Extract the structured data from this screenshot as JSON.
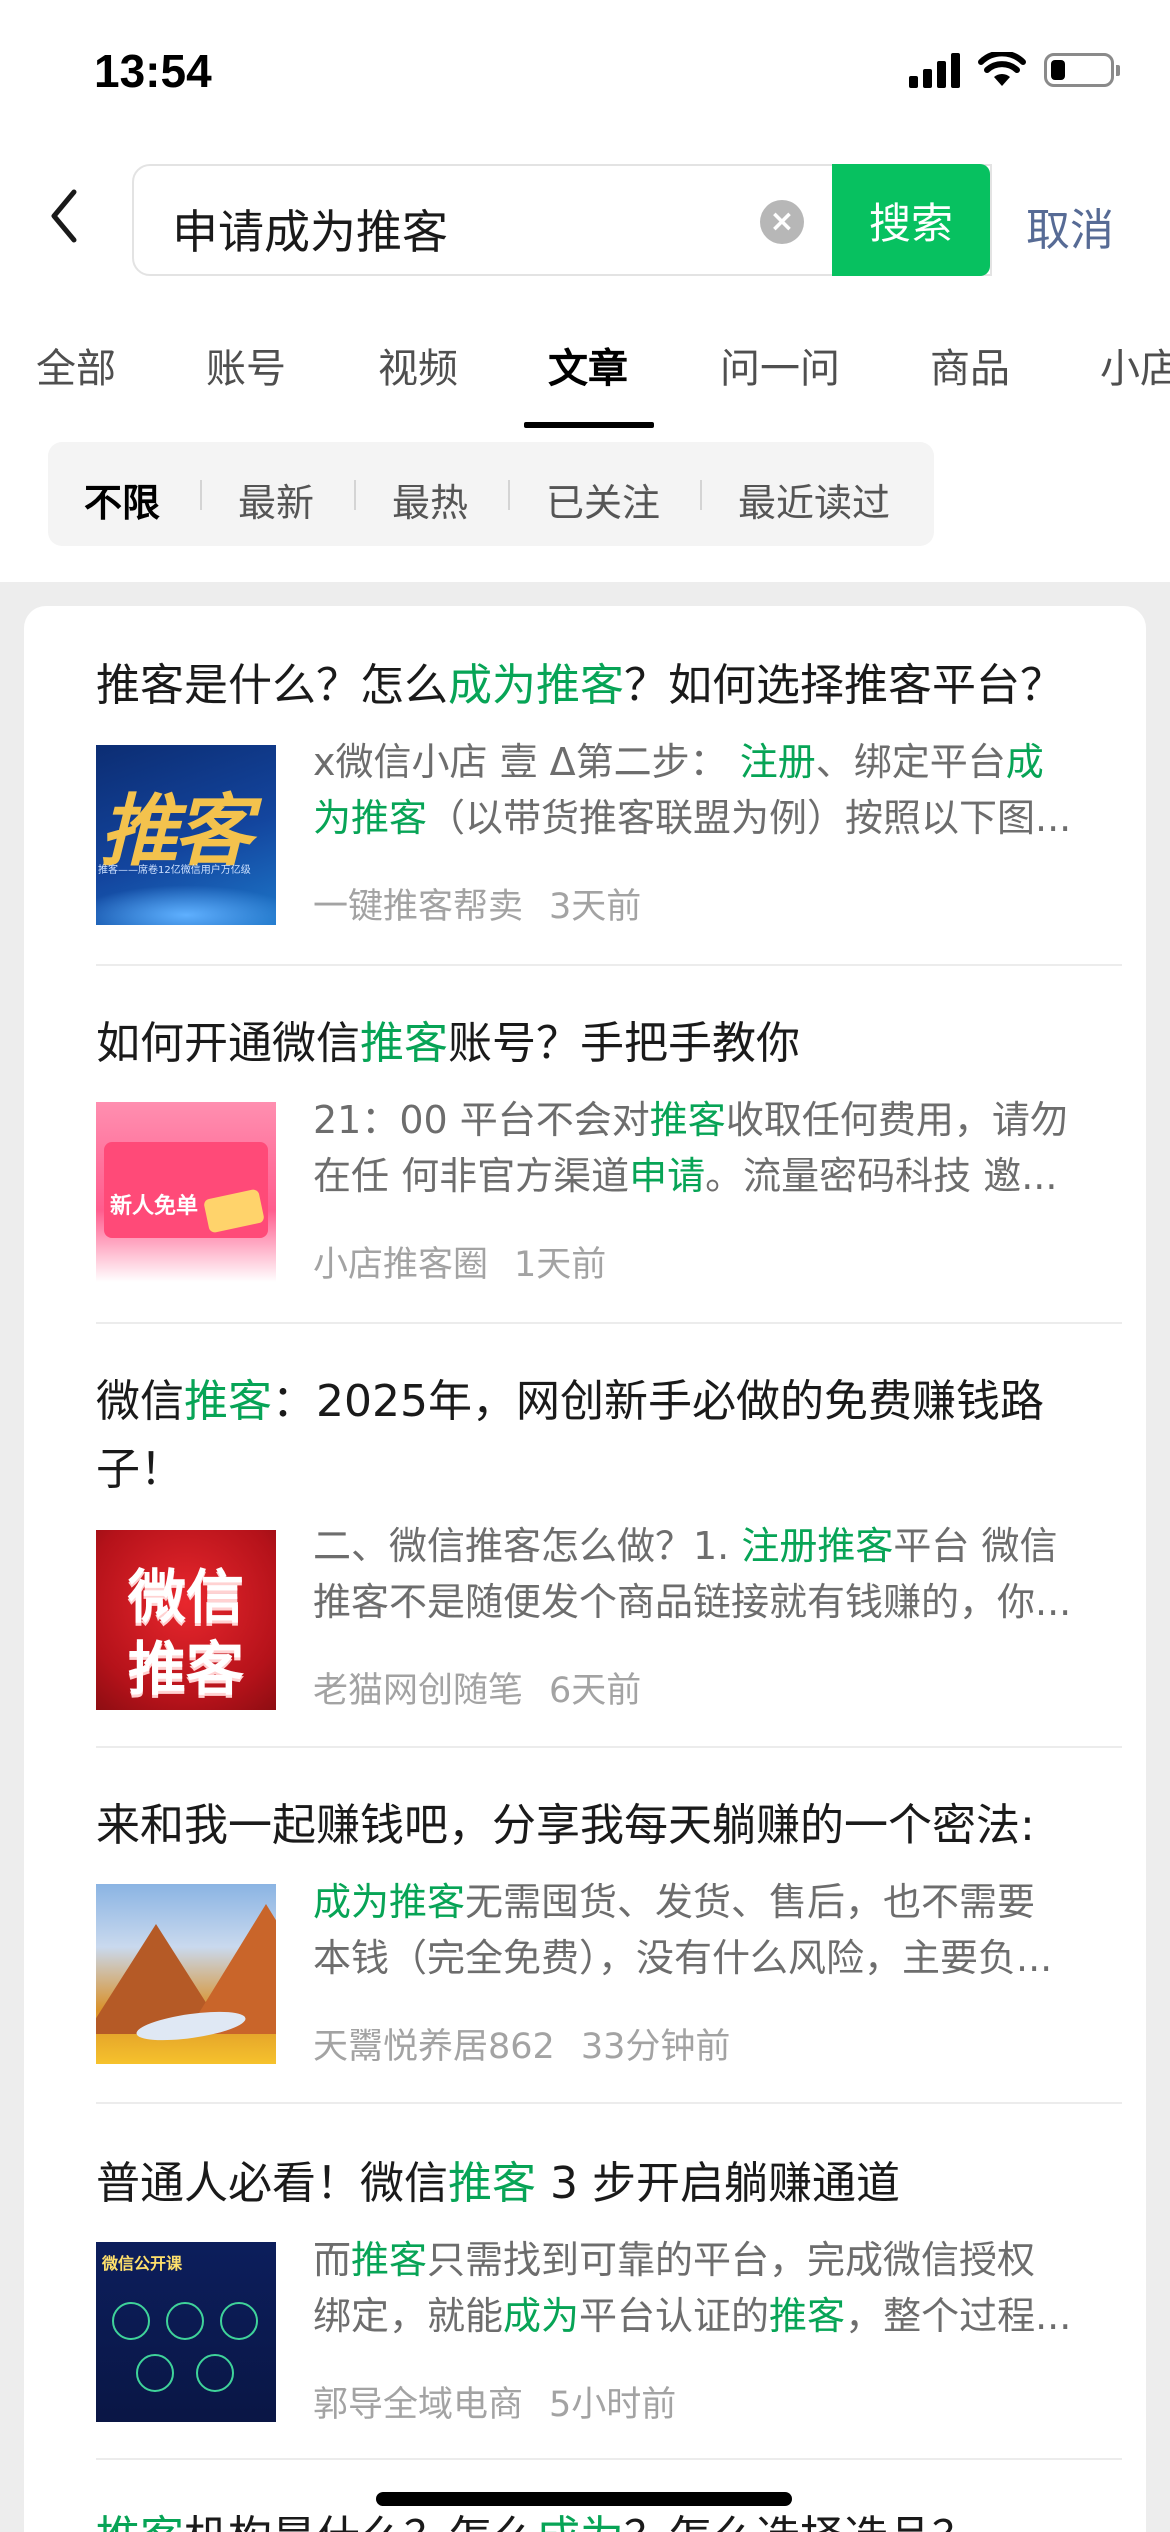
{
  "status_bar": {
    "time": "13:54"
  },
  "search": {
    "query": "申请成为推客",
    "button_label": "搜索",
    "cancel_label": "取消"
  },
  "tabs": [
    "全部",
    "账号",
    "视频",
    "文章",
    "问一问",
    "商品",
    "小店"
  ],
  "active_tab": "文章",
  "filters": [
    "不限",
    "最新",
    "最热",
    "已关注",
    "最近读过"
  ],
  "active_filter": "不限",
  "highlight_color": "#07a456",
  "thumb_texts": {
    "a1_big": "推客",
    "a1_small": "推客——席卷12亿微信用户万亿级",
    "a2_big": "新人免单",
    "a3_line1": "微信",
    "a3_line2": "推客",
    "a5_header": "微信公开课"
  },
  "articles": [
    {
      "title": [
        "推客是什么？怎么",
        "成为推客",
        "？如何选择推客平台？"
      ],
      "excerpt_line1": [
        "x微信小店 壹 Δ第二步： ",
        "注册",
        "、绑定平台",
        "成"
      ],
      "excerpt_line2": [
        "为推客",
        "（以带货推客联盟为例）按照以下图..."
      ],
      "source": "一键推客帮卖",
      "age": "3天前"
    },
    {
      "title": [
        "如何开通微信",
        "推客",
        "账号？手把手教你"
      ],
      "excerpt_line1": [
        "21：00 平台不会对",
        "推客",
        "收取任何费用，请勿"
      ],
      "excerpt_line2": [
        "在任 何非官方渠道",
        "申请",
        "。流量密码科技 邀..."
      ],
      "source": "小店推客圈",
      "age": "1天前"
    },
    {
      "title_line1": [
        "微信",
        "推客",
        "：2025年，网创新手必做的免费赚钱路"
      ],
      "title_line2": "子！",
      "excerpt_line1": [
        "二、微信推客怎么做？1. ",
        "注册推客",
        "平台 微信"
      ],
      "excerpt_line2": "推客不是随便发个商品链接就有钱赚的，你...",
      "source": "老猫网创随笔",
      "age": "6天前"
    },
    {
      "title": "来和我一起赚钱吧，分享我每天躺赚的一个密法:",
      "excerpt_line1": [
        "成为推客",
        "无需囤货、发货、售后，也不需要"
      ],
      "excerpt_line2": "本钱（完全免费），没有什么风险，主要负...",
      "source": "天鬻悦养居862",
      "age": "33分钟前"
    },
    {
      "title": [
        "普通人必看！微信",
        "推客",
        " 3 步开启躺赚通道"
      ],
      "excerpt_line1": [
        "而",
        "推客",
        "只需找到可靠的平台，完成微信授权"
      ],
      "excerpt_line2": [
        "绑定，就能",
        "成为",
        "平台认证的",
        "推客",
        "，整个过程..."
      ],
      "source": "郭导全域电商",
      "age": "5小时前"
    },
    {
      "title": [
        "推客",
        "机构是什么？怎么",
        "成为",
        "？怎么选择选品？"
      ]
    }
  ]
}
